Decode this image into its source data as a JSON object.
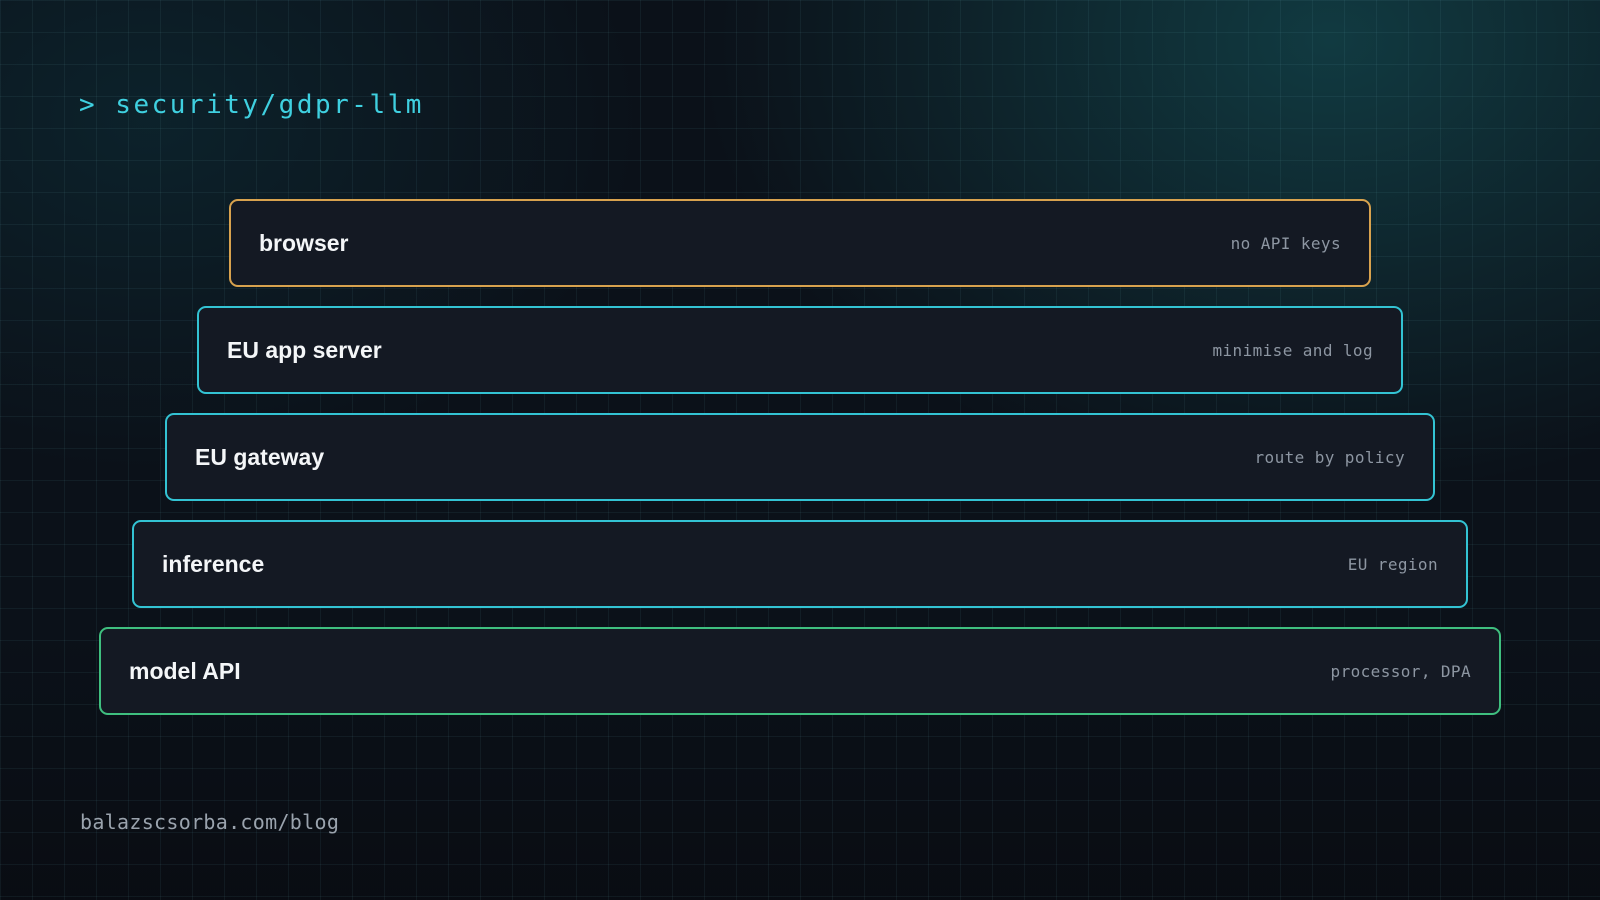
{
  "title": "> security/gdpr-llm",
  "layers": [
    {
      "name": "browser",
      "note": "no API keys",
      "border_color": "#d8a24e"
    },
    {
      "name": "EU app server",
      "note": "minimise and log",
      "border_color": "#33c3d3"
    },
    {
      "name": "EU gateway",
      "note": "route by policy",
      "border_color": "#33c3d3"
    },
    {
      "name": "inference",
      "note": "EU region",
      "border_color": "#33c3d3"
    },
    {
      "name": "model API",
      "note": "processor, DPA",
      "border_color": "#3fbf7f"
    }
  ],
  "footer": {
    "url": "balazscsorba.com/blog"
  },
  "colors": {
    "background": "#0b1119",
    "title_accent": "#3fd0e0",
    "panel_fill": "#141923"
  }
}
